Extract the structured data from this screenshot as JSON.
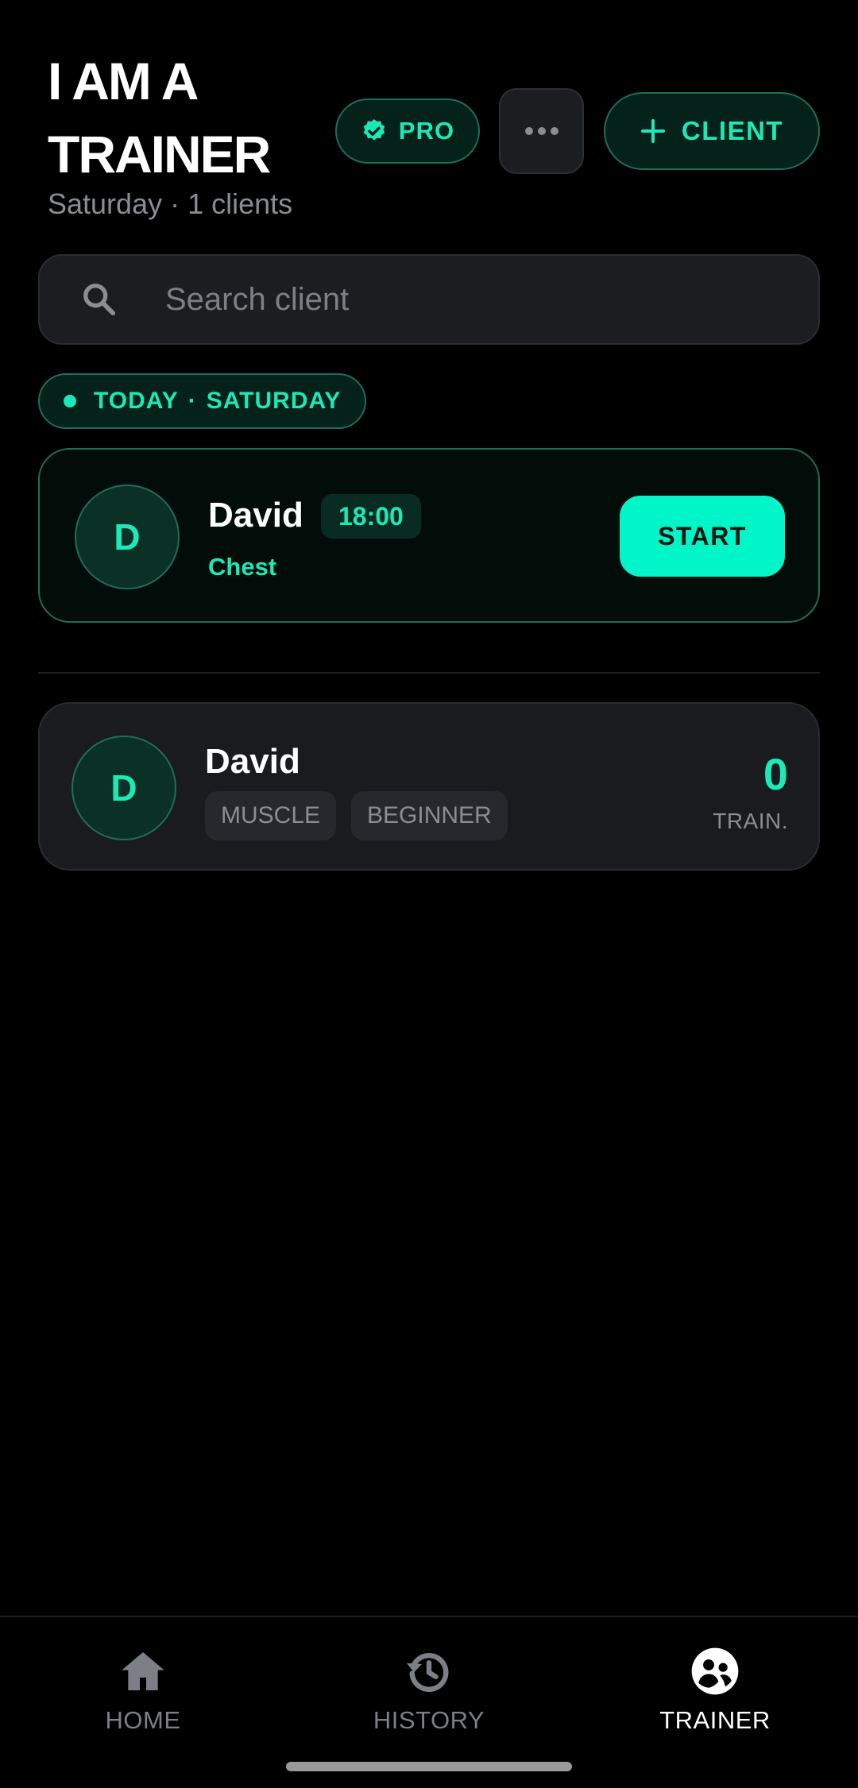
{
  "header": {
    "title": "I AM A TRAINER",
    "subtitle": "Saturday · 1 clients",
    "pro_label": "PRO",
    "add_client_label": "CLIENT"
  },
  "search": {
    "placeholder": "Search client",
    "value": ""
  },
  "today": {
    "label": "TODAY",
    "separator": "·",
    "day": "SATURDAY"
  },
  "session": {
    "avatar_initial": "D",
    "client_name": "David",
    "time": "18:00",
    "focus": "Chest",
    "start_label": "START"
  },
  "clients": [
    {
      "avatar_initial": "D",
      "name": "David",
      "tags": [
        "MUSCLE",
        "BEGINNER"
      ],
      "train_count": "0",
      "train_label": "TRAIN."
    }
  ],
  "nav": {
    "items": [
      {
        "label": "HOME",
        "icon": "home-icon",
        "active": false
      },
      {
        "label": "HISTORY",
        "icon": "history-icon",
        "active": false
      },
      {
        "label": "TRAINER",
        "icon": "trainer-icon",
        "active": true
      }
    ]
  },
  "colors": {
    "accent": "#1de9b6",
    "start_button": "#00f5c8",
    "background": "#000000",
    "card": "#1a1b1f"
  }
}
